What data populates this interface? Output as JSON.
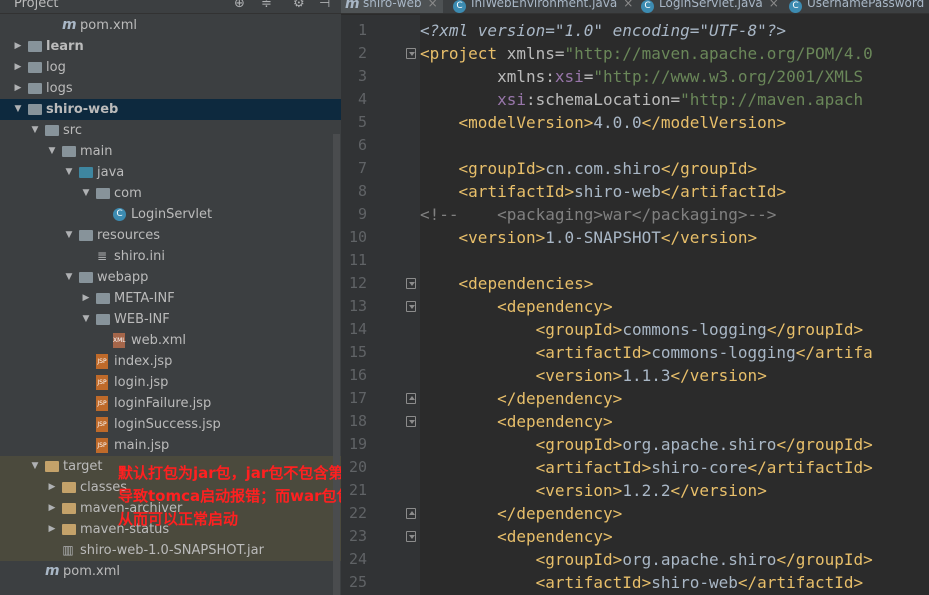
{
  "project_panel": {
    "title": "Project",
    "tree": [
      {
        "label": "pom.xml",
        "icon": "maven-file-icon",
        "indent": 3,
        "arrow": ""
      },
      {
        "label": "learn",
        "icon": "folder-icon",
        "indent": 1,
        "arrow": "▶",
        "bold": true
      },
      {
        "label": "log",
        "icon": "folder-icon",
        "indent": 1,
        "arrow": "▶"
      },
      {
        "label": "logs",
        "icon": "folder-icon",
        "indent": 1,
        "arrow": "▶"
      },
      {
        "label": "shiro-web",
        "icon": "folder-icon",
        "indent": 1,
        "arrow": "▼",
        "bold": true,
        "selected": true
      },
      {
        "label": "src",
        "icon": "folder-icon",
        "indent": 2,
        "arrow": "▼"
      },
      {
        "label": "main",
        "icon": "folder-icon",
        "indent": 3,
        "arrow": "▼"
      },
      {
        "label": "java",
        "icon": "source-folder-icon",
        "indent": 4,
        "arrow": "▼"
      },
      {
        "label": "com",
        "icon": "package-icon",
        "indent": 5,
        "arrow": "▼"
      },
      {
        "label": "LoginServlet",
        "icon": "class-icon",
        "indent": 6,
        "arrow": ""
      },
      {
        "label": "resources",
        "icon": "resources-folder-icon",
        "indent": 4,
        "arrow": "▼"
      },
      {
        "label": "shiro.ini",
        "icon": "ini-file-icon",
        "indent": 5,
        "arrow": ""
      },
      {
        "label": "webapp",
        "icon": "web-folder-icon",
        "indent": 4,
        "arrow": "▼"
      },
      {
        "label": "META-INF",
        "icon": "folder-icon",
        "indent": 5,
        "arrow": "▶"
      },
      {
        "label": "WEB-INF",
        "icon": "folder-icon",
        "indent": 5,
        "arrow": "▼"
      },
      {
        "label": "web.xml",
        "icon": "web-xml-icon",
        "indent": 6,
        "arrow": ""
      },
      {
        "label": "index.jsp",
        "icon": "jsp-file-icon",
        "indent": 5,
        "arrow": ""
      },
      {
        "label": "login.jsp",
        "icon": "jsp-file-icon",
        "indent": 5,
        "arrow": ""
      },
      {
        "label": "loginFailure.jsp",
        "icon": "jsp-file-icon",
        "indent": 5,
        "arrow": ""
      },
      {
        "label": "loginSuccess.jsp",
        "icon": "jsp-file-icon",
        "indent": 5,
        "arrow": ""
      },
      {
        "label": "main.jsp",
        "icon": "jsp-file-icon",
        "indent": 5,
        "arrow": ""
      },
      {
        "label": "target",
        "icon": "excluded-folder-icon",
        "indent": 2,
        "arrow": "▼",
        "target": true
      },
      {
        "label": "classes",
        "icon": "excluded-folder-icon",
        "indent": 3,
        "arrow": "▶",
        "target": true
      },
      {
        "label": "maven-archiver",
        "icon": "excluded-folder-icon",
        "indent": 3,
        "arrow": "▶",
        "target": true
      },
      {
        "label": "maven-status",
        "icon": "excluded-folder-icon",
        "indent": 3,
        "arrow": "▶",
        "target": true
      },
      {
        "label": "shiro-web-1.0-SNAPSHOT.jar",
        "icon": "jar-file-icon",
        "indent": 3,
        "arrow": "",
        "target": true
      },
      {
        "label": "pom.xml",
        "icon": "maven-file-icon",
        "indent": 2,
        "arrow": ""
      }
    ]
  },
  "annotation": {
    "lines": [
      "默认打包为jar包，jar包不包含第三方shiro的依赖jar包，",
      "导致tomca启动报错；而war包包含shiro的jar包依赖，",
      "从而可以正常启动"
    ],
    "color": "#ff2020"
  },
  "tabs": [
    {
      "label": "shiro-web",
      "icon": "m",
      "active": true
    },
    {
      "label": "IniWebEnvironment.java",
      "icon": "c"
    },
    {
      "label": "LoginServlet.java",
      "icon": "c"
    },
    {
      "label": "UsernamePassword",
      "icon": "c"
    }
  ],
  "code_lines": [
    {
      "n": "1",
      "fold": "",
      "html": [
        [
          "t-decl",
          "<?xml version=\"1.0\" encoding=\"UTF-8\"?>"
        ]
      ]
    },
    {
      "n": "2",
      "fold": "open",
      "html": [
        [
          "t-bracket",
          "<"
        ],
        [
          "t-tag",
          "project "
        ],
        [
          "t-attr",
          "xmlns="
        ],
        [
          "t-val",
          "\"http://maven.apache.org/POM/4.0"
        ]
      ]
    },
    {
      "n": "3",
      "fold": "",
      "html": [
        [
          "t-txt",
          "        "
        ],
        [
          "t-attr",
          "xmlns:"
        ],
        [
          "t-ns",
          "xsi"
        ],
        [
          "t-attr",
          "="
        ],
        [
          "t-val",
          "\"http://www.w3.org/2001/XMLS"
        ]
      ]
    },
    {
      "n": "4",
      "fold": "",
      "html": [
        [
          "t-txt",
          "        "
        ],
        [
          "t-ns",
          "xsi"
        ],
        [
          "t-attr",
          ":schemaLocation="
        ],
        [
          "t-val",
          "\"http://maven.apach"
        ]
      ]
    },
    {
      "n": "5",
      "fold": "",
      "html": [
        [
          "t-txt",
          "    "
        ],
        [
          "t-bracket",
          "<"
        ],
        [
          "t-tag",
          "modelVersion"
        ],
        [
          "t-bracket",
          ">"
        ],
        [
          "t-txt",
          "4.0.0"
        ],
        [
          "t-bracket",
          "</"
        ],
        [
          "t-tag",
          "modelVersion"
        ],
        [
          "t-bracket",
          ">"
        ]
      ]
    },
    {
      "n": "6",
      "fold": "",
      "html": []
    },
    {
      "n": "7",
      "fold": "",
      "html": [
        [
          "t-txt",
          "    "
        ],
        [
          "t-bracket",
          "<"
        ],
        [
          "t-tag",
          "groupId"
        ],
        [
          "t-bracket",
          ">"
        ],
        [
          "t-txt",
          "cn.com.shiro"
        ],
        [
          "t-bracket",
          "</"
        ],
        [
          "t-tag",
          "groupId"
        ],
        [
          "t-bracket",
          ">"
        ]
      ]
    },
    {
      "n": "8",
      "fold": "",
      "html": [
        [
          "t-txt",
          "    "
        ],
        [
          "t-bracket",
          "<"
        ],
        [
          "t-tag",
          "artifactId"
        ],
        [
          "t-bracket",
          ">"
        ],
        [
          "t-txt",
          "shiro-web"
        ],
        [
          "t-bracket",
          "</"
        ],
        [
          "t-tag",
          "artifactId"
        ],
        [
          "t-bracket",
          ">"
        ]
      ]
    },
    {
      "n": "9",
      "fold": "",
      "html": [
        [
          "t-comment",
          "<!--    <packaging>war</packaging>-->"
        ]
      ]
    },
    {
      "n": "10",
      "fold": "",
      "html": [
        [
          "t-txt",
          "    "
        ],
        [
          "t-bracket",
          "<"
        ],
        [
          "t-tag",
          "version"
        ],
        [
          "t-bracket",
          ">"
        ],
        [
          "t-txt",
          "1.0-SNAPSHOT"
        ],
        [
          "t-bracket",
          "</"
        ],
        [
          "t-tag",
          "version"
        ],
        [
          "t-bracket",
          ">"
        ]
      ]
    },
    {
      "n": "11",
      "fold": "",
      "html": []
    },
    {
      "n": "12",
      "fold": "open",
      "html": [
        [
          "t-txt",
          "    "
        ],
        [
          "t-bracket",
          "<"
        ],
        [
          "t-tag",
          "dependencies"
        ],
        [
          "t-bracket",
          ">"
        ]
      ]
    },
    {
      "n": "13",
      "fold": "open",
      "html": [
        [
          "t-txt",
          "        "
        ],
        [
          "t-bracket",
          "<"
        ],
        [
          "t-tag",
          "dependency"
        ],
        [
          "t-bracket",
          ">"
        ]
      ]
    },
    {
      "n": "14",
      "fold": "",
      "html": [
        [
          "t-txt",
          "            "
        ],
        [
          "t-bracket",
          "<"
        ],
        [
          "t-tag",
          "groupId"
        ],
        [
          "t-bracket",
          ">"
        ],
        [
          "t-txt",
          "commons-logging"
        ],
        [
          "t-bracket",
          "</"
        ],
        [
          "t-tag",
          "groupId"
        ],
        [
          "t-bracket",
          ">"
        ]
      ]
    },
    {
      "n": "15",
      "fold": "",
      "html": [
        [
          "t-txt",
          "            "
        ],
        [
          "t-bracket",
          "<"
        ],
        [
          "t-tag",
          "artifactId"
        ],
        [
          "t-bracket",
          ">"
        ],
        [
          "t-txt",
          "commons-logging"
        ],
        [
          "t-bracket",
          "</"
        ],
        [
          "t-tag",
          "artifa"
        ]
      ]
    },
    {
      "n": "16",
      "fold": "",
      "html": [
        [
          "t-txt",
          "            "
        ],
        [
          "t-bracket",
          "<"
        ],
        [
          "t-tag",
          "version"
        ],
        [
          "t-bracket",
          ">"
        ],
        [
          "t-txt",
          "1.1.3"
        ],
        [
          "t-bracket",
          "</"
        ],
        [
          "t-tag",
          "version"
        ],
        [
          "t-bracket",
          ">"
        ]
      ]
    },
    {
      "n": "17",
      "fold": "close",
      "html": [
        [
          "t-txt",
          "        "
        ],
        [
          "t-bracket",
          "</"
        ],
        [
          "t-tag",
          "dependency"
        ],
        [
          "t-bracket",
          ">"
        ]
      ]
    },
    {
      "n": "18",
      "fold": "open",
      "html": [
        [
          "t-txt",
          "        "
        ],
        [
          "t-bracket",
          "<"
        ],
        [
          "t-tag",
          "dependency"
        ],
        [
          "t-bracket",
          ">"
        ]
      ]
    },
    {
      "n": "19",
      "fold": "",
      "html": [
        [
          "t-txt",
          "            "
        ],
        [
          "t-bracket",
          "<"
        ],
        [
          "t-tag",
          "groupId"
        ],
        [
          "t-bracket",
          ">"
        ],
        [
          "t-txt",
          "org.apache.shiro"
        ],
        [
          "t-bracket",
          "</"
        ],
        [
          "t-tag",
          "groupId"
        ],
        [
          "t-bracket",
          ">"
        ]
      ]
    },
    {
      "n": "20",
      "fold": "",
      "html": [
        [
          "t-txt",
          "            "
        ],
        [
          "t-bracket",
          "<"
        ],
        [
          "t-tag",
          "artifactId"
        ],
        [
          "t-bracket",
          ">"
        ],
        [
          "t-txt",
          "shiro-core"
        ],
        [
          "t-bracket",
          "</"
        ],
        [
          "t-tag",
          "artifactId"
        ],
        [
          "t-bracket",
          ">"
        ]
      ]
    },
    {
      "n": "21",
      "fold": "",
      "html": [
        [
          "t-txt",
          "            "
        ],
        [
          "t-bracket",
          "<"
        ],
        [
          "t-tag",
          "version"
        ],
        [
          "t-bracket",
          ">"
        ],
        [
          "t-txt",
          "1.2.2"
        ],
        [
          "t-bracket",
          "</"
        ],
        [
          "t-tag",
          "version"
        ],
        [
          "t-bracket",
          ">"
        ]
      ]
    },
    {
      "n": "22",
      "fold": "close",
      "html": [
        [
          "t-txt",
          "        "
        ],
        [
          "t-bracket",
          "</"
        ],
        [
          "t-tag",
          "dependency"
        ],
        [
          "t-bracket",
          ">"
        ]
      ]
    },
    {
      "n": "23",
      "fold": "open",
      "html": [
        [
          "t-txt",
          "        "
        ],
        [
          "t-bracket",
          "<"
        ],
        [
          "t-tag",
          "dependency"
        ],
        [
          "t-bracket",
          ">"
        ]
      ]
    },
    {
      "n": "24",
      "fold": "",
      "html": [
        [
          "t-txt",
          "            "
        ],
        [
          "t-bracket",
          "<"
        ],
        [
          "t-tag",
          "groupId"
        ],
        [
          "t-bracket",
          ">"
        ],
        [
          "t-txt",
          "org.apache.shiro"
        ],
        [
          "t-bracket",
          "</"
        ],
        [
          "t-tag",
          "groupId"
        ],
        [
          "t-bracket",
          ">"
        ]
      ]
    },
    {
      "n": "25",
      "fold": "",
      "html": [
        [
          "t-txt",
          "            "
        ],
        [
          "t-bracket",
          "<"
        ],
        [
          "t-tag",
          "artifactId"
        ],
        [
          "t-bracket",
          ">"
        ],
        [
          "t-txt",
          "shiro-web"
        ],
        [
          "t-bracket",
          "</"
        ],
        [
          "t-tag",
          "artifactId"
        ],
        [
          "t-bracket",
          ">"
        ]
      ]
    }
  ]
}
